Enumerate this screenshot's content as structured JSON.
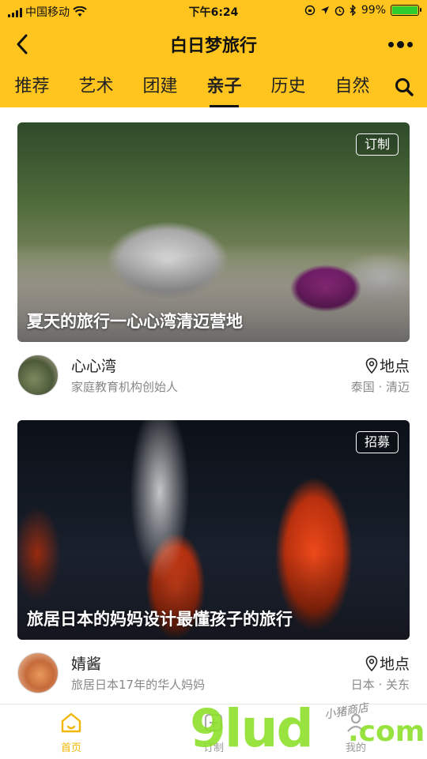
{
  "status_bar": {
    "carrier": "中国移动",
    "time": "下午6:24",
    "battery": "99%",
    "battery_level": 0.99
  },
  "header": {
    "title": "白日梦旅行",
    "back_icon": "back-arrow-icon",
    "more_icon": "more-dots-icon"
  },
  "tabs": {
    "items": [
      "推荐",
      "艺术",
      "团建",
      "亲子",
      "历史",
      "自然"
    ],
    "active": "亲子",
    "search_icon": "search-icon"
  },
  "cards": [
    {
      "tag": "订制",
      "title": "夏天的旅行一心心湾清迈营地",
      "author": "心心湾",
      "bio": "家庭教育机构创始人",
      "location_label": "地点",
      "location": "泰国 · 清迈"
    },
    {
      "tag": "招募",
      "title": "旅居日本的妈妈设计最懂孩子的旅行",
      "author": "婧酱",
      "bio": "旅居日本17年的华人妈妈",
      "location_label": "地点",
      "location": "日本 · 关东"
    }
  ],
  "bottom_nav": {
    "items": [
      {
        "label": "首页",
        "icon": "home-icon",
        "active": true
      },
      {
        "label": "订制",
        "icon": "customize-icon",
        "active": false
      },
      {
        "label": "我的",
        "icon": "profile-icon",
        "active": false
      }
    ]
  },
  "watermark": {
    "brand": "9lud",
    "suffix": ".com",
    "text": "小猪商店"
  },
  "colors": {
    "accent": "#FFC51E",
    "nav_active": "#F2B705",
    "text_muted": "#888888",
    "battery_green": "#2ecc2e"
  }
}
